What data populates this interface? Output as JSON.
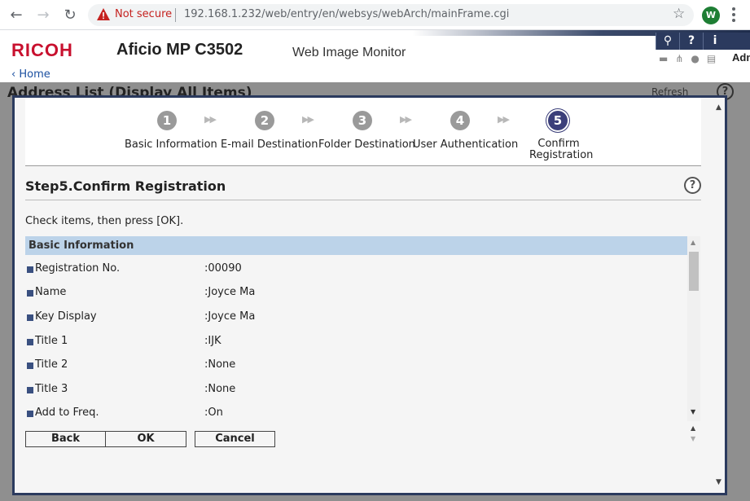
{
  "browser": {
    "security_label": "Not secure",
    "url": "192.168.1.232/web/entry/en/websys/webArch/mainFrame.cgi",
    "profile_initial": "W"
  },
  "header": {
    "brand": "RICOH",
    "model": "Aficio MP C3502",
    "product": "Web Image Monitor",
    "user": "Adm",
    "tools": [
      "⚲",
      "?",
      "i"
    ]
  },
  "background": {
    "home_link": "Home",
    "page_title": "Address List (Display All Items)",
    "refresh_label": "Refresh",
    "help_label": "?"
  },
  "wizard": {
    "steps": [
      {
        "num": "1",
        "label": "Basic Information"
      },
      {
        "num": "2",
        "label": "E-mail Destination"
      },
      {
        "num": "3",
        "label": "Folder Destination"
      },
      {
        "num": "4",
        "label": "User Authentication"
      },
      {
        "num": "5",
        "label_line1": "Confirm",
        "label_line2": "Registration"
      }
    ],
    "arrow": "▶▶",
    "title": "Step5.Confirm Registration",
    "help_label": "?",
    "instruction": "Check items, then press [OK].",
    "section_header": "Basic Information",
    "rows": [
      {
        "label": "Registration No.",
        "value": ":00090"
      },
      {
        "label": "Name",
        "value": ":Joyce Ma"
      },
      {
        "label": "Key Display",
        "value": ":Joyce Ma"
      },
      {
        "label": "Title 1",
        "value": ":IJK"
      },
      {
        "label": "Title 2",
        "value": ":None"
      },
      {
        "label": "Title 3",
        "value": ":None"
      },
      {
        "label": "Add to Freq.",
        "value": ":On"
      }
    ],
    "buttons": {
      "back": "Back",
      "ok": "OK",
      "cancel": "Cancel"
    }
  }
}
